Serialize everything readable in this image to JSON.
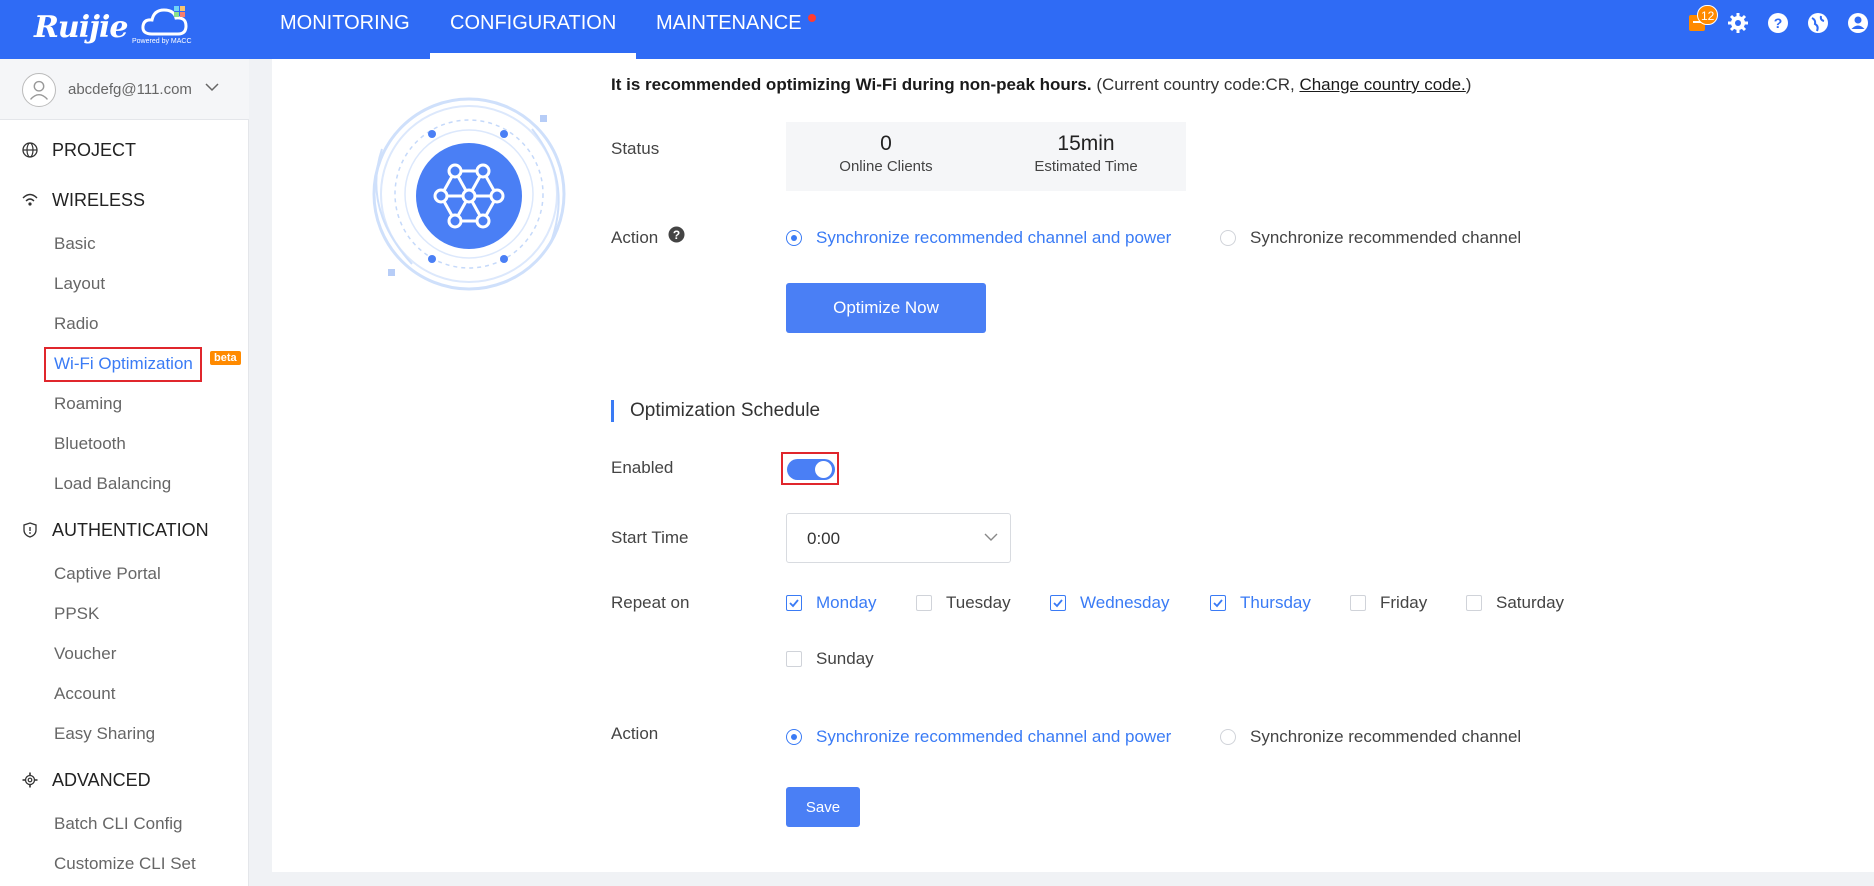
{
  "brand": {
    "logo": "Ruijie",
    "powered_by": "Powered by MACC"
  },
  "topnav": {
    "items": [
      "MONITORING",
      "CONFIGURATION",
      "MAINTENANCE"
    ],
    "active": "CONFIGURATION",
    "notification_count": "12",
    "icons": [
      "notification-icon",
      "settings-icon",
      "help-icon",
      "language-icon",
      "user-icon"
    ]
  },
  "sidebar": {
    "user_email": "abcdefg@111.com",
    "sections": [
      {
        "label": "PROJECT",
        "icon": "globe-icon",
        "items": []
      },
      {
        "label": "WIRELESS",
        "icon": "wifi-icon",
        "items": [
          "Basic",
          "Layout",
          "Radio",
          "Wi-Fi Optimization",
          "Roaming",
          "Bluetooth",
          "Load Balancing"
        ]
      },
      {
        "label": "AUTHENTICATION",
        "icon": "shield-icon",
        "items": [
          "Captive Portal",
          "PPSK",
          "Voucher",
          "Account",
          "Easy Sharing"
        ]
      },
      {
        "label": "ADVANCED",
        "icon": "gear-icon",
        "items": [
          "Batch CLI Config",
          "Customize CLI Set"
        ]
      }
    ],
    "active_item": "Wi-Fi Optimization",
    "beta_label": "beta"
  },
  "main": {
    "recommend_bold": "It is recommended optimizing Wi-Fi during non-peak hours.",
    "recommend_rest": " (Current country code:CR, ",
    "change_country_link": "Change country code.",
    "recommend_close": ")",
    "status_label": "Status",
    "online_clients_value": "0",
    "online_clients_caption": "Online Clients",
    "estimated_time_value": "15min",
    "estimated_time_caption": "Estimated Time",
    "action_label": "Action",
    "action_option_1": "Synchronize recommended channel and power",
    "action_option_2": "Synchronize recommended channel",
    "optimize_button": "Optimize Now",
    "schedule_title": "Optimization Schedule",
    "enabled_label": "Enabled",
    "enabled": true,
    "start_time_label": "Start Time",
    "start_time_value": "0:00",
    "repeat_label": "Repeat on",
    "days": [
      {
        "name": "Monday",
        "checked": true
      },
      {
        "name": "Tuesday",
        "checked": false
      },
      {
        "name": "Wednesday",
        "checked": true
      },
      {
        "name": "Thursday",
        "checked": true
      },
      {
        "name": "Friday",
        "checked": false
      },
      {
        "name": "Saturday",
        "checked": false
      },
      {
        "name": "Sunday",
        "checked": false
      }
    ],
    "schedule_action_label": "Action",
    "schedule_action_option_1": "Synchronize recommended channel and power",
    "schedule_action_option_2": "Synchronize recommended channel",
    "save_button": "Save"
  },
  "colors": {
    "topbar": "#2f6bf5",
    "accent": "#3a7bf5",
    "highlight_border": "#e0262c",
    "badge": "#ff8a00"
  }
}
